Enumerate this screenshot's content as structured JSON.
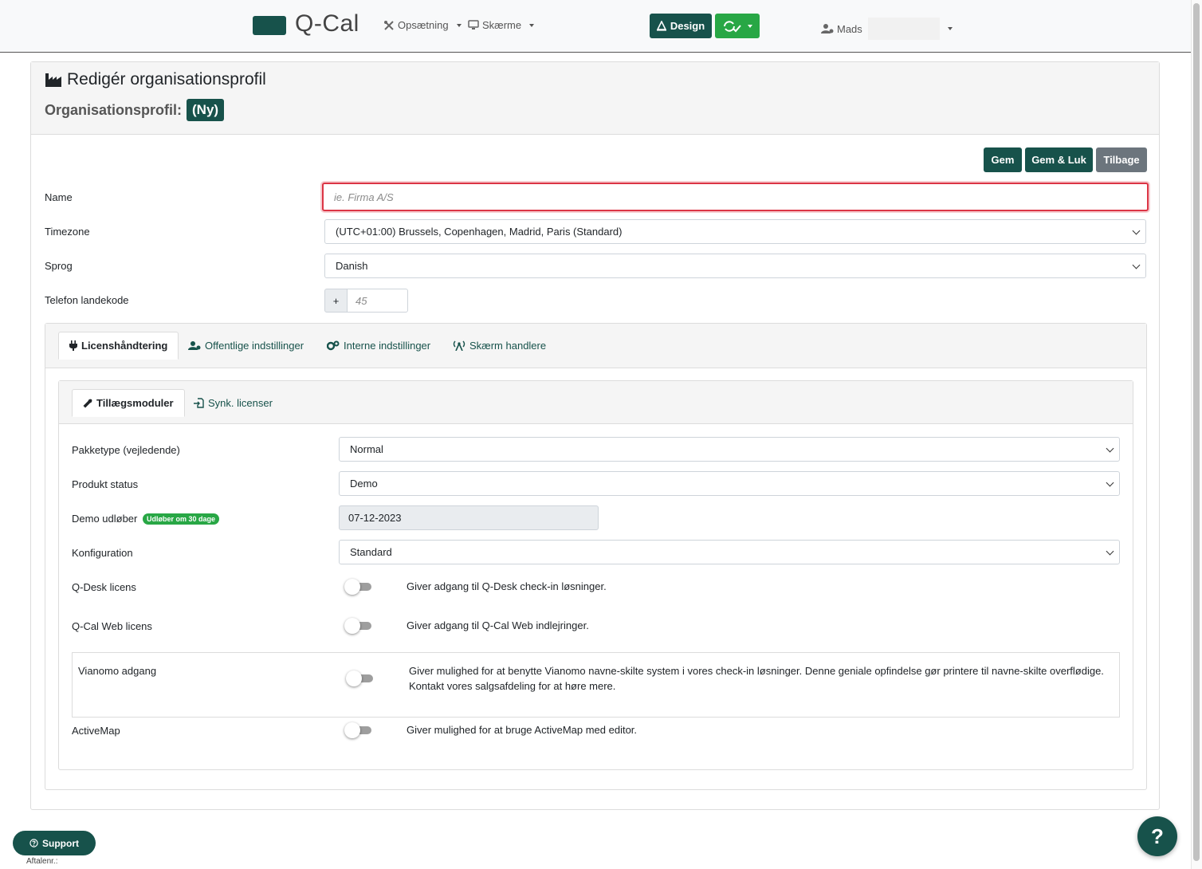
{
  "nav": {
    "brand": "Q-Cal",
    "setup_label": "Opsætning",
    "screens_label": "Skærme",
    "design_label": "Design",
    "user_name": "Mads"
  },
  "header": {
    "title": "Redigér organisationsprofil",
    "profile_label": "Organisationsprofil:",
    "profile_badge": "(Ny)"
  },
  "actions": {
    "save": "Gem",
    "save_close": "Gem & Luk",
    "back": "Tilbage"
  },
  "form": {
    "name_label": "Name",
    "name_placeholder": "ie. Firma A/S",
    "timezone_label": "Timezone",
    "timezone_value": "(UTC+01:00) Brussels, Copenhagen, Madrid, Paris (Standard)",
    "language_label": "Sprog",
    "language_value": "Danish",
    "phone_label": "Telefon landekode",
    "phone_prefix": "+",
    "phone_placeholder": "45"
  },
  "tabs": {
    "license": "Licenshåndtering",
    "public": "Offentlige indstillinger",
    "internal": "Interne indstillinger",
    "screen_handlers": "Skærm handlere"
  },
  "subtabs": {
    "addons": "Tillægsmoduler",
    "sync": "Synk. licenser"
  },
  "license": {
    "package_label": "Pakketype (vejledende)",
    "package_value": "Normal",
    "status_label": "Produkt status",
    "status_value": "Demo",
    "demo_label": "Demo udløber",
    "demo_badge": "Udløber om 30 dage",
    "demo_value": "07-12-2023",
    "config_label": "Konfiguration",
    "config_value": "Standard",
    "qdesk_label": "Q-Desk licens",
    "qdesk_desc": "Giver adgang til Q-Desk check-in løsninger.",
    "qdesk_on": false,
    "qcalweb_label": "Q-Cal Web licens",
    "qcalweb_desc": "Giver adgang til Q-Cal Web indlejringer.",
    "qcalweb_on": false,
    "vianomo_label": "Vianomo adgang",
    "vianomo_desc": "Giver mulighed for at benytte Vianomo navne-skilte system i vores check-in løsninger. Denne geniale opfindelse gør printere til navne-skilte overflødige. Kontakt vores salgsafdeling for at høre mere.",
    "vianomo_on": false,
    "activemap_label": "ActiveMap",
    "activemap_desc": "Giver mulighed for at bruge ActiveMap med editor.",
    "activemap_on": false
  },
  "footer": {
    "support_label": "Support",
    "agreement_label": "Aftalenr.:",
    "help_label": "?"
  },
  "colors": {
    "brand": "#17524b",
    "success": "#28a745",
    "danger": "#dc3545",
    "secondary": "#6c757d"
  }
}
